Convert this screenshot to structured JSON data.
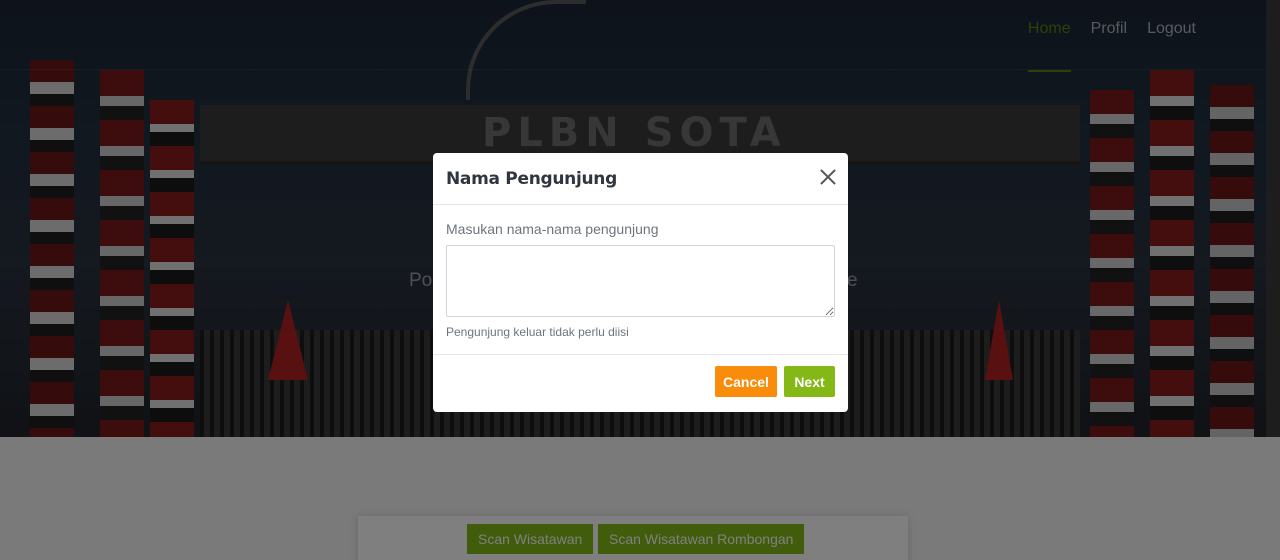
{
  "nav": {
    "items": [
      {
        "label": "Home",
        "active": true
      },
      {
        "label": "Profil",
        "active": false
      },
      {
        "label": "Logout",
        "active": false
      }
    ]
  },
  "hero": {
    "gate_sign": "PLBN SOTA",
    "subtitle_start": "Po",
    "subtitle_end": "e"
  },
  "scan_buttons": {
    "scan_wisatawan": "Scan Wisatawan",
    "scan_rombongan": "Scan Wisatawan Rombongan"
  },
  "modal": {
    "title": "Nama Pengunjung",
    "field_label": "Masukan nama-nama pengunjung",
    "textarea_value": "",
    "help_text": "Pengunjung keluar tidak perlu diisi",
    "cancel_label": "Cancel",
    "next_label": "Next"
  },
  "colors": {
    "accent_green": "#83b817",
    "nav_active": "#5e7e10",
    "cancel_orange": "#f98c0a"
  }
}
